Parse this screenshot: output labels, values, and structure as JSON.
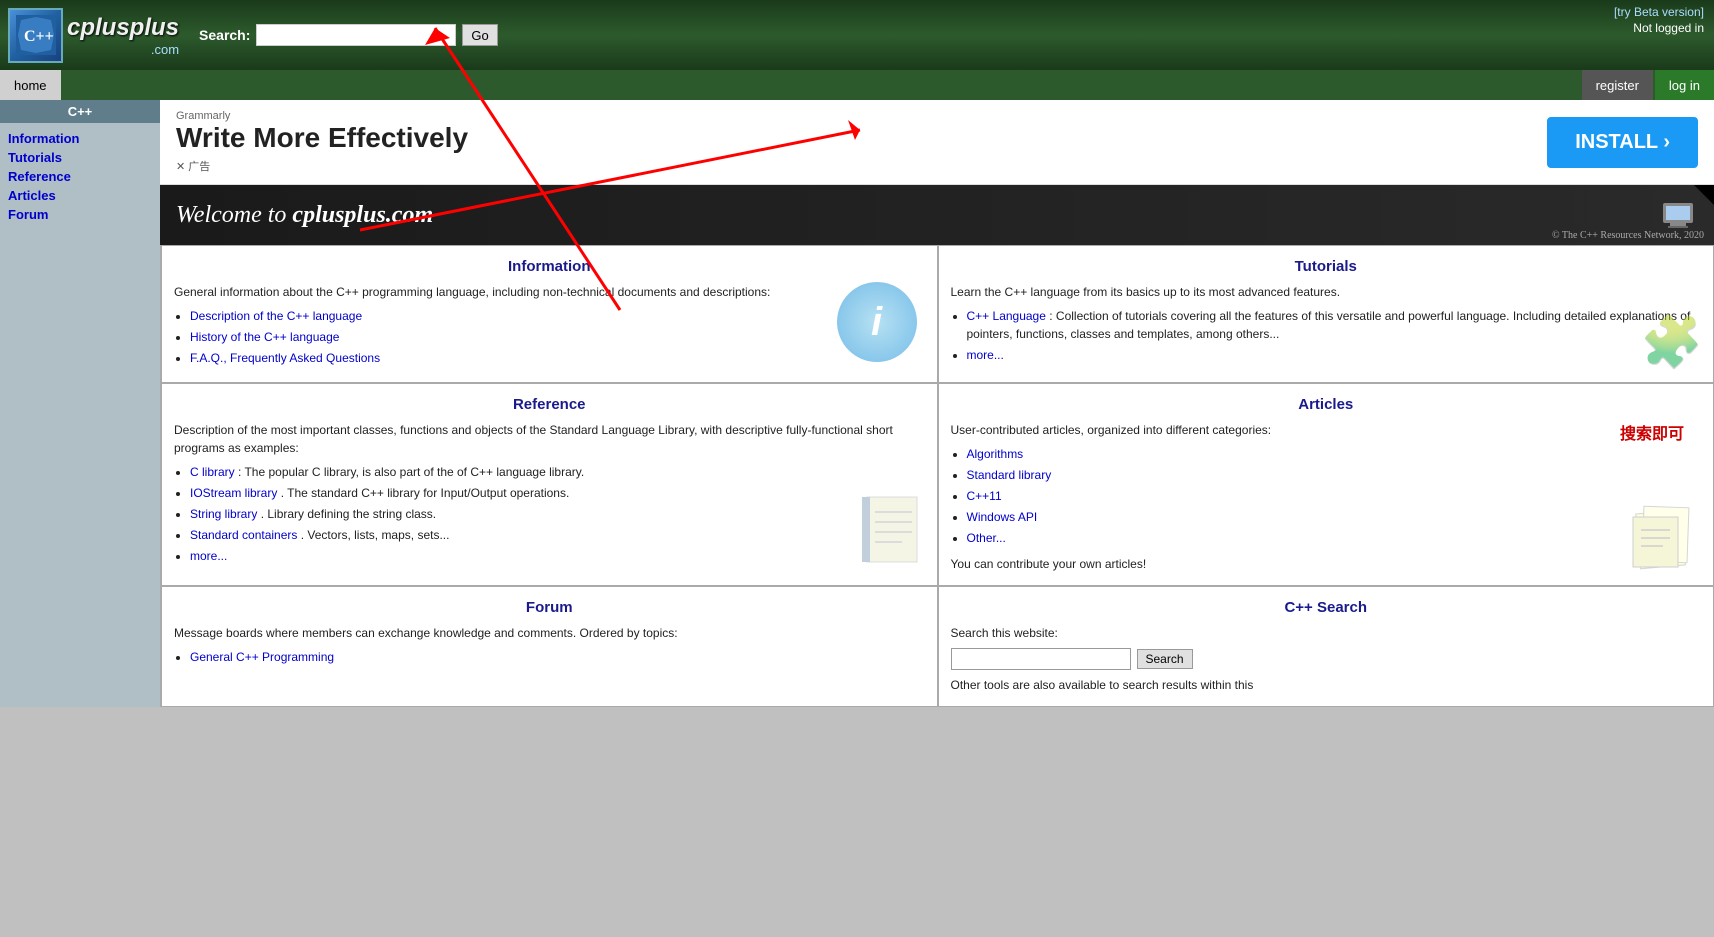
{
  "header": {
    "search_label": "Search:",
    "search_placeholder": "",
    "go_button": "Go",
    "beta_link": "[try Beta version]",
    "not_logged_in": "Not logged in",
    "home_button": "home",
    "register_button": "register",
    "login_button": "log in"
  },
  "logo": {
    "name": "cplusplus",
    "dot_com": ".com"
  },
  "sidebar": {
    "title": "C++",
    "items": [
      {
        "label": "Information",
        "href": "#"
      },
      {
        "label": "Tutorials",
        "href": "#"
      },
      {
        "label": "Reference",
        "href": "#"
      },
      {
        "label": "Articles",
        "href": "#"
      },
      {
        "label": "Forum",
        "href": "#"
      }
    ]
  },
  "ad": {
    "company": "Grammarly",
    "headline": "Write More Effectively",
    "close_text": "✕ 广告",
    "install_button": "INSTALL ›"
  },
  "welcome": {
    "text": "Welcome to",
    "domain": "cplusplus.com",
    "copyright": "© The C++ Resources Network, 2020"
  },
  "sections": {
    "information": {
      "title": "Information",
      "description": "General information about the C++ programming language, including non-technical documents and descriptions:",
      "links": [
        {
          "text": "Description of the C++ language",
          "href": "#"
        },
        {
          "text": "History of the C++ language",
          "href": "#"
        },
        {
          "text": "F.A.Q., Frequently Asked Questions",
          "href": "#"
        }
      ]
    },
    "tutorials": {
      "title": "Tutorials",
      "description": "Learn the C++ language from its basics up to its most advanced features.",
      "links": [
        {
          "text": "C++ Language",
          "href": "#",
          "suffix": ": Collection of tutorials covering all the features of this versatile and powerful language. Including detailed explanations of pointers, functions, classes and templates, among others..."
        },
        {
          "text": "more...",
          "href": "#"
        }
      ]
    },
    "reference": {
      "title": "Reference",
      "description": "Description of the most important classes, functions and objects of the Standard Language Library, with descriptive fully-functional short programs as examples:",
      "links": [
        {
          "text": "C library",
          "href": "#",
          "suffix": ": The popular C library, is also part of the of C++ language library."
        },
        {
          "text": "IOStream library",
          "href": "#",
          "suffix": ". The standard C++ library for Input/Output operations."
        },
        {
          "text": "String library",
          "href": "#",
          "suffix": ". Library defining the string class."
        },
        {
          "text": "Standard containers",
          "href": "#",
          "suffix": ". Vectors, lists, maps, sets..."
        },
        {
          "text": "more...",
          "href": "#"
        }
      ]
    },
    "articles": {
      "title": "Articles",
      "description": "User-contributed articles, organized into different categories:",
      "links": [
        {
          "text": "Algorithms",
          "href": "#"
        },
        {
          "text": "Standard library",
          "href": "#"
        },
        {
          "text": "C++11",
          "href": "#"
        },
        {
          "text": "Windows API",
          "href": "#"
        },
        {
          "text": "Other...",
          "href": "#"
        }
      ],
      "contribute": "You can contribute your own articles!"
    },
    "forum": {
      "title": "Forum",
      "description": "Message boards where members can exchange knowledge and comments. Ordered by topics:",
      "links": [
        {
          "text": "General C++ Programming",
          "href": "#"
        }
      ]
    },
    "search": {
      "title": "C++ Search",
      "search_label": "Search this website:",
      "search_button": "Search",
      "other_tools": "Other tools are also available to search results within this"
    }
  },
  "annotation": {
    "chinese_text": "搜索即可"
  }
}
